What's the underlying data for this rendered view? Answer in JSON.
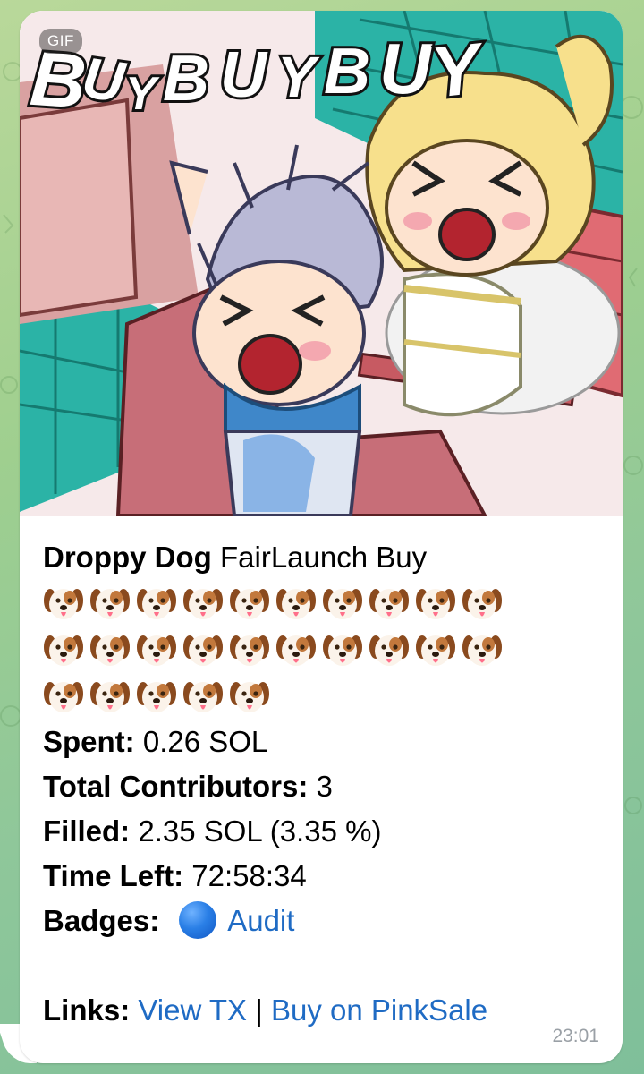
{
  "media": {
    "badge": "GIF",
    "title_art": "BUYBUYBUY"
  },
  "message": {
    "title_bold": "Droppy Dog",
    "title_rest": " FairLaunch Buy",
    "emoji_counts": [
      10,
      10,
      5
    ],
    "emoji_name": "dog-face-emoji",
    "spent_label": "Spent:",
    "spent_value": " 0.26 SOL",
    "contributors_label": "Total Contributors:",
    "contributors_value": " 3",
    "filled_label": "Filled:",
    "filled_value": " 2.35 SOL (3.35 %)",
    "time_label": "Time Left:",
    "time_value": " 72:58:34",
    "badges_label": "Badges:",
    "badge_icon": "blue-circle-icon",
    "badge_text": "Audit",
    "links_label": "Links:",
    "link_tx": "View TX",
    "link_sep": " | ",
    "link_buy": "Buy on PinkSale",
    "timestamp": "23:01"
  },
  "colors": {
    "link": "#1f6bc4",
    "chat_bg": "#9fcf8f",
    "bubble_bg": "#ffffff",
    "timestamp": "#9aa0a6"
  }
}
